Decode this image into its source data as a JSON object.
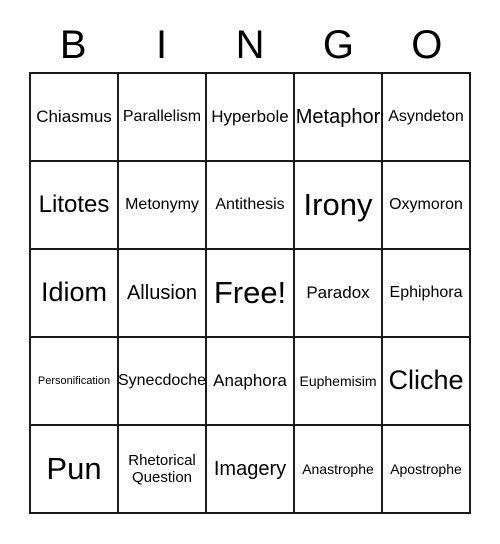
{
  "card": {
    "title": "BINGO",
    "header_letters": [
      "B",
      "I",
      "N",
      "G",
      "O"
    ],
    "border_color": "#1a1a1a",
    "background_color": "#ffffff",
    "text_color": "#000000",
    "rows": [
      [
        {
          "label": "Chiasmus",
          "size": "ml"
        },
        {
          "label": "Parallelism",
          "size": "m"
        },
        {
          "label": "Hyperbole",
          "size": "ml"
        },
        {
          "label": "Metaphor",
          "size": "l"
        },
        {
          "label": "Asyndeton",
          "size": "m"
        }
      ],
      [
        {
          "label": "Litotes",
          "size": "xl"
        },
        {
          "label": "Metonymy",
          "size": "m"
        },
        {
          "label": "Antithesis",
          "size": "m"
        },
        {
          "label": "Irony",
          "size": "huge"
        },
        {
          "label": "Oxymoron",
          "size": "m"
        }
      ],
      [
        {
          "label": "Idiom",
          "size": "xxl"
        },
        {
          "label": "Allusion",
          "size": "l"
        },
        {
          "label": "Free!",
          "size": "huge"
        },
        {
          "label": "Paradox",
          "size": "ml"
        },
        {
          "label": "Ephiphora",
          "size": "m"
        }
      ],
      [
        {
          "label": "Personification",
          "size": "xs"
        },
        {
          "label": "Synecdoche",
          "size": "m"
        },
        {
          "label": "Anaphora",
          "size": "ml"
        },
        {
          "label": "Euphemisim",
          "size": "s"
        },
        {
          "label": "Cliche",
          "size": "xxl"
        }
      ],
      [
        {
          "label": "Pun",
          "size": "huge"
        },
        {
          "label": "Rhetorical\nQuestion",
          "size": "sm"
        },
        {
          "label": "Imagery",
          "size": "l"
        },
        {
          "label": "Anastrophe",
          "size": "s"
        },
        {
          "label": "Apostrophe",
          "size": "s"
        }
      ]
    ]
  }
}
